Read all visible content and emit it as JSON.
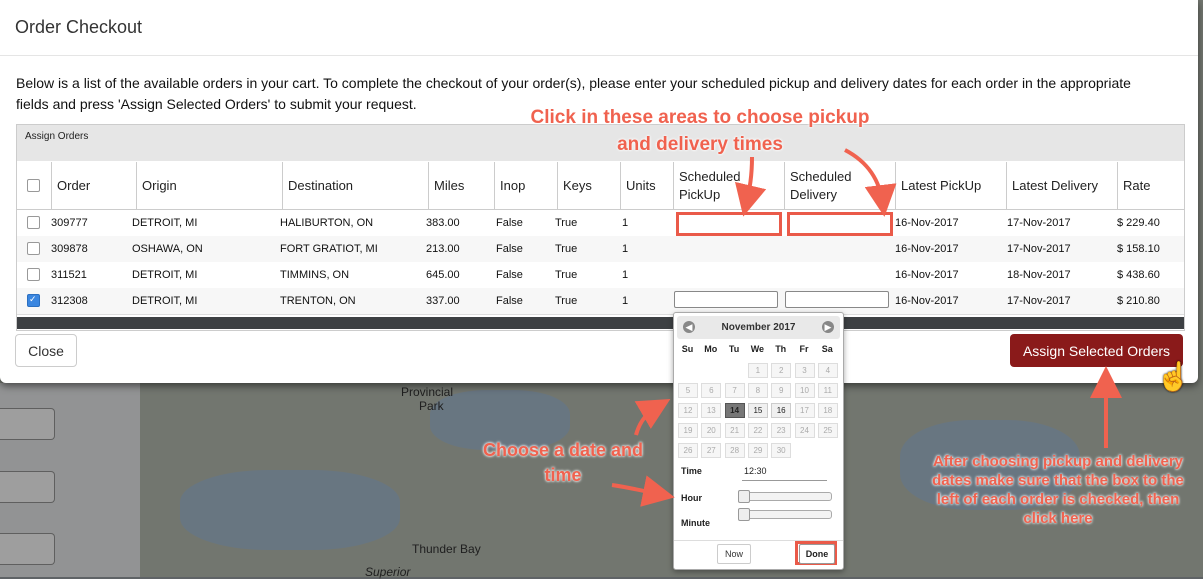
{
  "modal": {
    "title": "Order Checkout",
    "intro": "Below is a list of the available orders in your cart. To complete the checkout of your order(s), please enter your scheduled pickup and delivery dates for each order in the appropriate fields and press 'Assign Selected Orders' to submit your request.",
    "grid_caption": "Assign Orders",
    "close_label": "Close",
    "assign_label": "Assign Selected Orders"
  },
  "columns": [
    "Order",
    "Origin",
    "Destination",
    "Miles",
    "Inop",
    "Keys",
    "Units",
    "Scheduled PickUp",
    "Scheduled Delivery",
    "Latest PickUp",
    "Latest Delivery",
    "Rate"
  ],
  "rows": [
    {
      "checked": false,
      "order": "309777",
      "origin": "DETROIT, MI",
      "destination": "HALIBURTON, ON",
      "miles": "383.00",
      "inop": "False",
      "keys": "True",
      "units": "1",
      "latest_pickup": "16-Nov-2017",
      "latest_delivery": "17-Nov-2017",
      "rate": "$ 229.40"
    },
    {
      "checked": false,
      "order": "309878",
      "origin": "OSHAWA, ON",
      "destination": "FORT GRATIOT, MI",
      "miles": "213.00",
      "inop": "False",
      "keys": "True",
      "units": "1",
      "latest_pickup": "16-Nov-2017",
      "latest_delivery": "17-Nov-2017",
      "rate": "$ 158.10"
    },
    {
      "checked": false,
      "order": "311521",
      "origin": "DETROIT, MI",
      "destination": "TIMMINS, ON",
      "miles": "645.00",
      "inop": "False",
      "keys": "True",
      "units": "1",
      "latest_pickup": "16-Nov-2017",
      "latest_delivery": "18-Nov-2017",
      "rate": "$ 438.60"
    },
    {
      "checked": true,
      "order": "312308",
      "origin": "DETROIT, MI",
      "destination": "TRENTON, ON",
      "miles": "337.00",
      "inop": "False",
      "keys": "True",
      "units": "1",
      "latest_pickup": "16-Nov-2017",
      "latest_delivery": "17-Nov-2017",
      "rate": "$ 210.80"
    }
  ],
  "calendar": {
    "month": "November 2017",
    "weekdays": [
      "Su",
      "Mo",
      "Tu",
      "We",
      "Th",
      "Fr",
      "Sa"
    ],
    "weeks": [
      [
        "",
        "",
        "",
        "1",
        "2",
        "3",
        "4"
      ],
      [
        "5",
        "6",
        "7",
        "8",
        "9",
        "10",
        "11"
      ],
      [
        "12",
        "13",
        "14",
        "15",
        "16",
        "17",
        "18"
      ],
      [
        "19",
        "20",
        "21",
        "22",
        "23",
        "24",
        "25"
      ],
      [
        "26",
        "27",
        "28",
        "29",
        "30",
        "",
        ""
      ]
    ],
    "today": "14",
    "enabled_days": [
      "15",
      "16"
    ],
    "time_label": "Time",
    "time_value": "12:30",
    "hour_label": "Hour",
    "minute_label": "Minute",
    "hour_level": 0,
    "minute_level": 0,
    "now_label": "Now",
    "done_label": "Done"
  },
  "map_labels": {
    "provincial": "Provincial",
    "park": "Park",
    "thunder_bay": "Thunder Bay",
    "superior": "Superior"
  },
  "annotations": {
    "click_areas": "Click in these areas to choose pickup and delivery times",
    "choose_date": "Choose a date and time",
    "after_choosing": "After choosing pickup and delivery dates make sure that the box to the left of each order is checked, then click here"
  },
  "colors": {
    "accent": "#8a1a1a",
    "annotation": "#f0624f",
    "checkbox": "#3a86e0"
  }
}
